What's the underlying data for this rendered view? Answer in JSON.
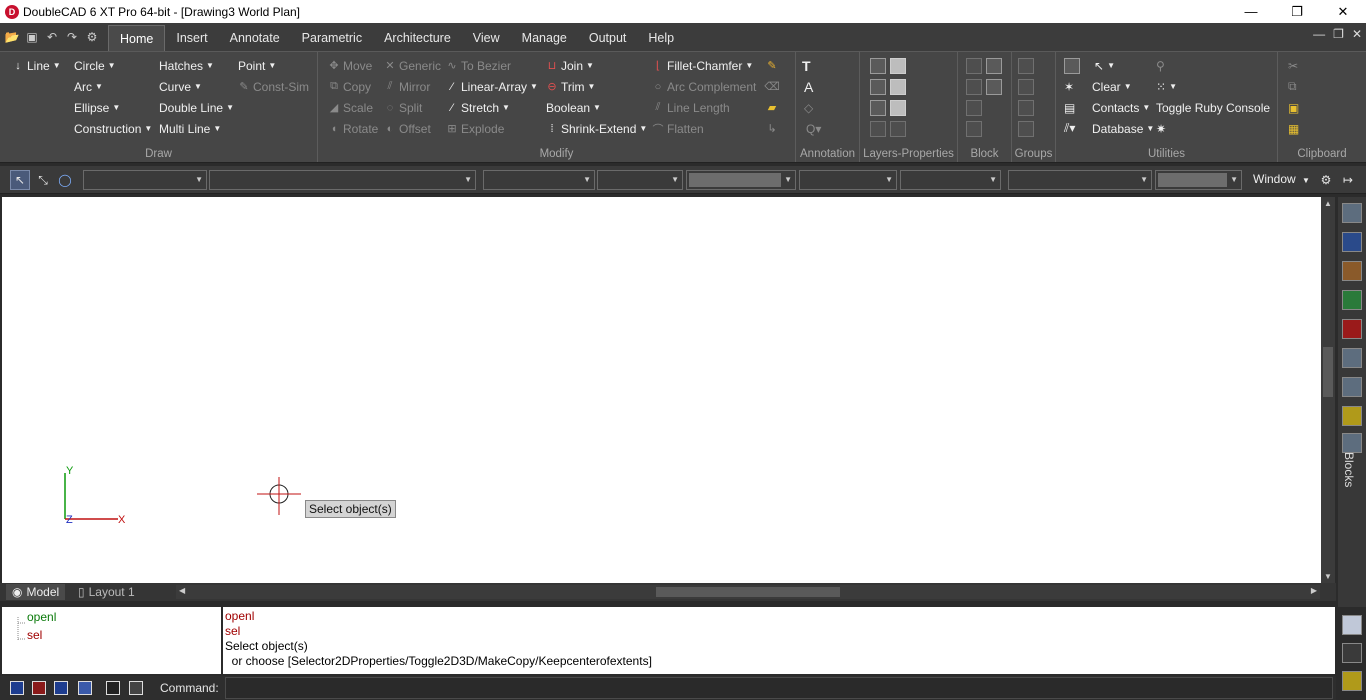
{
  "window": {
    "title": "DoubleCAD 6 XT Pro 64-bit - [Drawing3 World Plan]",
    "controls": [
      "—",
      "❐",
      "✕"
    ]
  },
  "menu": {
    "tabs": [
      {
        "label": "Home",
        "active": true
      },
      {
        "label": "Insert"
      },
      {
        "label": "Annotate"
      },
      {
        "label": "Parametric"
      },
      {
        "label": "Architecture"
      },
      {
        "label": "View"
      },
      {
        "label": "Manage"
      },
      {
        "label": "Output"
      },
      {
        "label": "Help"
      }
    ]
  },
  "ribbon": {
    "draw": {
      "label": "Draw",
      "items": [
        "Line",
        "Circle",
        "Hatches",
        "Point",
        "Arc",
        "Curve",
        "Const-Sim",
        "Ellipse",
        "Double Line",
        "Construction",
        "Multi Line"
      ]
    },
    "modify": {
      "label": "Modify",
      "items": [
        "Move",
        "Generic",
        "To Bezier",
        "Join",
        "Fillet-Chamfer",
        "Copy",
        "Mirror",
        "Linear-Array",
        "Trim",
        "Arc Complement",
        "Scale",
        "Split",
        "Stretch",
        "Boolean",
        "Line Length",
        "Rotate",
        "Offset",
        "Explode",
        "Shrink-Extend",
        "Flatten"
      ]
    },
    "annotation": {
      "label": "Annotation"
    },
    "layers": {
      "label": "Layers-Properties"
    },
    "block": {
      "label": "Block"
    },
    "groups": {
      "label": "Groups"
    },
    "utilities": {
      "label": "Utilities",
      "items": [
        "Clear",
        "Contacts",
        "Toggle Ruby Console",
        "Database"
      ]
    },
    "clipboard": {
      "label": "Clipboard"
    }
  },
  "proptoolbar": {
    "window_label": "Window"
  },
  "canvas": {
    "tooltip": "Select object(s)",
    "axis_y": "Y",
    "axis_x": "X",
    "axis_z": "Z"
  },
  "layout_tabs": [
    "Model",
    "Layout 1"
  ],
  "right_dock": {
    "blocks_label": "Blocks"
  },
  "command": {
    "history": [
      "openl",
      "sel"
    ],
    "output": [
      "openl",
      "sel",
      "Select object(s)",
      "  or choose [Selector2DProperties/Toggle2D3D/MakeCopy/Keepcenterofextents]"
    ],
    "label": "Command:",
    "value": ""
  },
  "colors": {
    "ribbon_bg": "#464646",
    "canvas_bg": "#ffffff",
    "accent_red": "#c8102e",
    "history_green": "#0a7a0a",
    "output_red": "#a00000"
  }
}
